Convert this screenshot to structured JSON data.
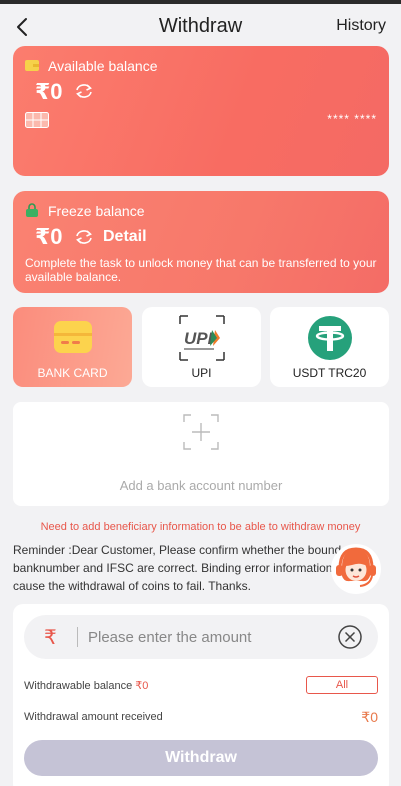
{
  "header": {
    "title": "Withdraw",
    "history_label": "History"
  },
  "available": {
    "label": "Available balance",
    "amount": "₹0",
    "masked_number": "**** ****"
  },
  "freeze": {
    "label": "Freeze balance",
    "amount": "₹0",
    "detail_label": "Detail",
    "description": "Complete the task to unlock money that can be transferred to your available balance."
  },
  "methods": [
    {
      "label": "BANK CARD",
      "icon": "bank-card-icon",
      "selected": true
    },
    {
      "label": "UPI",
      "icon": "upi-logo",
      "selected": false
    },
    {
      "label": "USDT TRC20",
      "icon": "tether-icon",
      "selected": false
    }
  ],
  "add_card": {
    "label": "Add a bank account number"
  },
  "notice": "Need to add beneficiary information to be able to withdraw money",
  "reminder": "Reminder :Dear Customer, Please confirm whether the bound banknumber and IFSC are correct. Binding error information will cause the withdrawal of coins to fail. Thanks.",
  "form": {
    "currency_symbol": "₹",
    "amount_placeholder": "Please enter the amount",
    "withdrawable_label": "Withdrawable balance",
    "withdrawable_value": "₹0",
    "all_label": "All",
    "received_label": "Withdrawal amount received",
    "received_value": "₹0",
    "submit_label": "Withdraw"
  },
  "colors": {
    "accent": "#e8574b",
    "card": "#f86c62",
    "button_disabled": "#c5c3d6",
    "tether": "#26a17b"
  }
}
